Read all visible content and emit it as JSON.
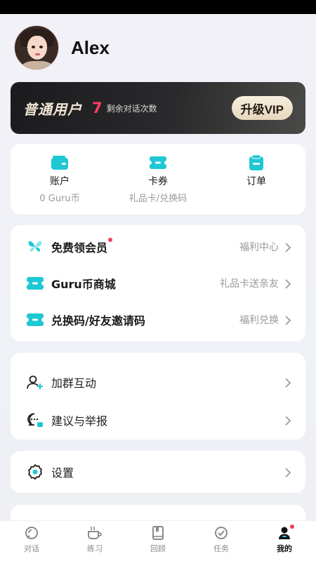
{
  "profile": {
    "username": "Alex"
  },
  "vip": {
    "title": "普通用户",
    "remaining_count": "7",
    "remaining_label": "剩余对话次数",
    "upgrade_label": "升级VIP"
  },
  "quick_actions": [
    {
      "label": "账户",
      "sub": "0 Guru币",
      "icon": "wallet-icon"
    },
    {
      "label": "卡券",
      "sub": "礼品卡/兑换码",
      "icon": "ticket-icon"
    },
    {
      "label": "订单",
      "sub": "",
      "icon": "order-icon"
    }
  ],
  "menu": {
    "group1": [
      {
        "label": "免费领会员",
        "right": "福利中心",
        "icon": "butterfly-icon",
        "badge": true
      },
      {
        "label": "Guru币商城",
        "right": "礼品卡送亲友",
        "icon": "ticket-icon"
      },
      {
        "label": "兑换码/好友邀请码",
        "right": "福利兑换",
        "icon": "ticket-icon"
      }
    ],
    "group2": [
      {
        "label": "加群互动",
        "icon": "add-user-icon"
      },
      {
        "label": "建议与举报",
        "icon": "feedback-icon"
      }
    ],
    "group3": [
      {
        "label": "设置",
        "icon": "gear-icon"
      }
    ]
  },
  "tabbar": [
    {
      "label": "对话",
      "icon": "chat-icon",
      "active": false
    },
    {
      "label": "练习",
      "icon": "coffee-icon",
      "active": false
    },
    {
      "label": "回顾",
      "icon": "book-icon",
      "active": false
    },
    {
      "label": "任务",
      "icon": "check-circle-icon",
      "active": false
    },
    {
      "label": "我的",
      "icon": "profile-icon",
      "active": true,
      "badge": true
    }
  ],
  "colors": {
    "accent": "#1ec8d4",
    "vip_count": "#ff3d66",
    "badge": "#f03d5c"
  }
}
